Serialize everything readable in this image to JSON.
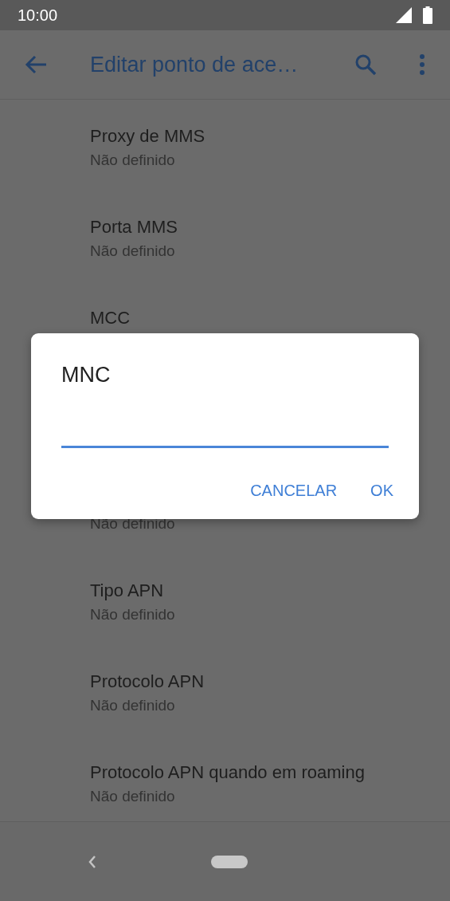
{
  "status_bar": {
    "time": "10:00"
  },
  "app_bar": {
    "title": "Editar ponto de ace…"
  },
  "settings": [
    {
      "title": "Proxy de MMS",
      "subtitle": "Não definido"
    },
    {
      "title": "Porta MMS",
      "subtitle": "Não definido"
    },
    {
      "title": "MCC"
    },
    {
      "subtitle": "Não definido"
    },
    {
      "title": "Tipo APN",
      "subtitle": "Não definido"
    },
    {
      "title": "Protocolo APN",
      "subtitle": "Não definido"
    },
    {
      "title": "Protocolo APN quando em roaming",
      "subtitle": "Não definido"
    }
  ],
  "dialog": {
    "title": "MNC",
    "field": {
      "focused": true
    },
    "buttons": [
      "CANCELAR",
      "OK"
    ]
  }
}
